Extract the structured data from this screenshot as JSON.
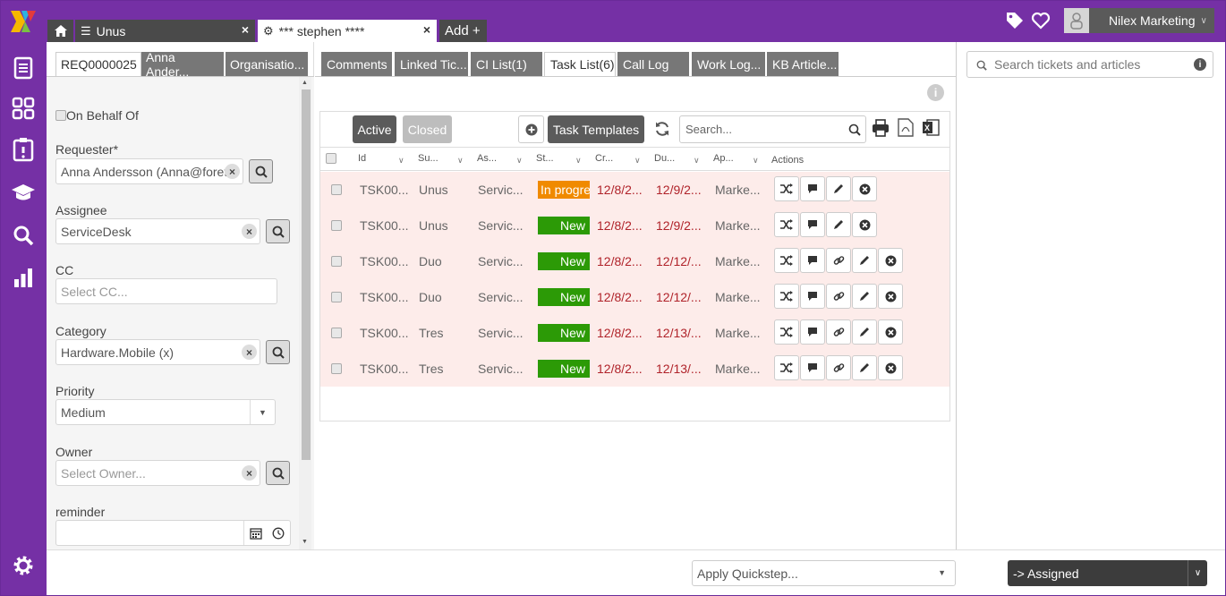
{
  "colors": {
    "brand": "#7530a5",
    "status_new": "#2c9a06",
    "status_progress": "#f08a00",
    "row_bg": "#fdecea",
    "date_red": "#b0232a"
  },
  "topbar": {
    "tabs": [
      {
        "label": "Unus",
        "close": "×",
        "icon": "list-icon"
      },
      {
        "label": "*** stephen ****",
        "close": "×",
        "icon": "gear-icon"
      },
      {
        "label": "Add +"
      }
    ],
    "user": {
      "name": "Nilex Marketing",
      "caret": "∨"
    }
  },
  "leftpanel": {
    "tabs": [
      "REQ0000025",
      "Anna Ander...",
      "Organisatio..."
    ],
    "on_behalf_label": "On Behalf Of",
    "requester": {
      "label": "Requester*",
      "value": "Anna Andersson (Anna@foret"
    },
    "assignee": {
      "label": "Assignee",
      "value": "ServiceDesk"
    },
    "cc": {
      "label": "CC",
      "placeholder": "Select CC..."
    },
    "category": {
      "label": "Category",
      "value": "Hardware.Mobile (x)"
    },
    "priority": {
      "label": "Priority",
      "value": "Medium"
    },
    "owner": {
      "label": "Owner",
      "placeholder": "Select Owner..."
    },
    "reminder": {
      "label": "reminder",
      "value": ""
    }
  },
  "middle": {
    "tabs": [
      "Comments",
      "Linked Tic...",
      "CI List(1)",
      "Task List(6)",
      "Call Log",
      "Work Log...",
      "KB Article..."
    ],
    "toolbar": {
      "active": "Active",
      "closed": "Closed",
      "templates": "Task Templates",
      "search_placeholder": "Search..."
    },
    "columns": [
      "Id",
      "Su...",
      "As...",
      "St...",
      "Cr...",
      "Du...",
      "Ap...",
      "Actions"
    ],
    "rows": [
      {
        "id": "TSK00...",
        "subject": "Unus",
        "assignee": "Servic...",
        "status": "In progre",
        "created": "12/8/2...",
        "due": "12/9/2...",
        "approver": "Marke..."
      },
      {
        "id": "TSK00...",
        "subject": "Unus",
        "assignee": "Servic...",
        "status": "New",
        "created": "12/8/2...",
        "due": "12/9/2...",
        "approver": "Marke..."
      },
      {
        "id": "TSK00...",
        "subject": "Duo",
        "assignee": "Servic...",
        "status": "New",
        "created": "12/8/2...",
        "due": "12/12/...",
        "approver": "Marke..."
      },
      {
        "id": "TSK00...",
        "subject": "Duo",
        "assignee": "Servic...",
        "status": "New",
        "created": "12/8/2...",
        "due": "12/12/...",
        "approver": "Marke..."
      },
      {
        "id": "TSK00...",
        "subject": "Tres",
        "assignee": "Servic...",
        "status": "New",
        "created": "12/8/2...",
        "due": "12/13/...",
        "approver": "Marke..."
      },
      {
        "id": "TSK00...",
        "subject": "Tres",
        "assignee": "Servic...",
        "status": "New",
        "created": "12/8/2...",
        "due": "12/13/...",
        "approver": "Marke..."
      }
    ]
  },
  "right": {
    "search_placeholder": "Search tickets and articles"
  },
  "bottom": {
    "quickstep_placeholder": "Apply Quickstep...",
    "assigned_label": "-> Assigned"
  }
}
